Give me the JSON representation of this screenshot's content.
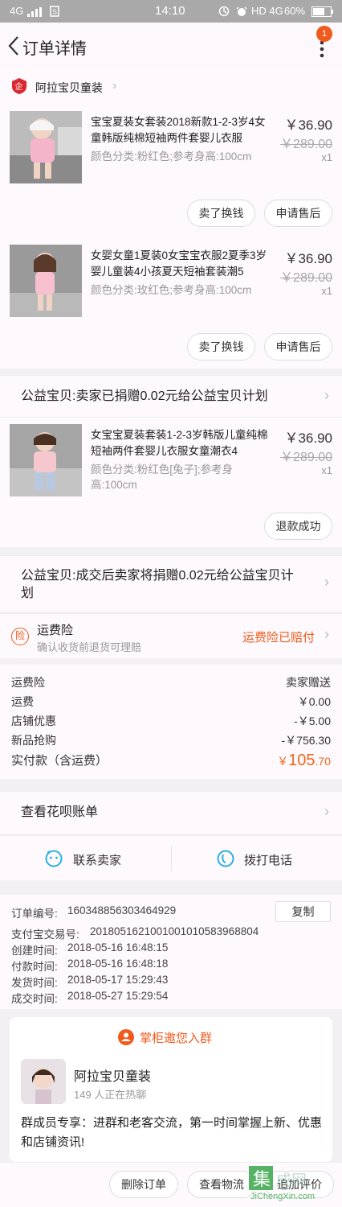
{
  "statusbar": {
    "network": "4G",
    "time": "14:10",
    "indicators": "HD 4G",
    "battery": "60%"
  },
  "navbar": {
    "title": "订单详情",
    "badge_count": "1"
  },
  "shop": {
    "name": "阿拉宝贝童装"
  },
  "items": [
    {
      "title": "宝宝夏装女套装2018新款1-2-3岁4女童韩版纯棉短袖两件套婴儿衣服",
      "sku": "颜色分类:粉红色;参考身高:100cm",
      "price": "￥36.90",
      "original_price": "￥289.00",
      "qty": "x1"
    },
    {
      "title": "女婴女童1夏装0女宝宝衣服2夏季3岁婴儿童装4小孩夏天短袖套装潮5",
      "sku": "颜色分类:玫红色;参考身高:100cm",
      "price": "￥36.90",
      "original_price": "￥289.00",
      "qty": "x1"
    },
    {
      "title": "女宝宝夏装套装1-2-3岁韩版儿童纯棉短袖两件套婴儿衣服女童潮衣4",
      "sku": "颜色分类:粉红色[兔子];参考身高:100cm",
      "price": "￥36.90",
      "original_price": "￥289.00",
      "qty": "x1"
    }
  ],
  "buttons": {
    "sell_exchange": "卖了换钱",
    "apply_aftersale": "申请售后",
    "refund_success": "退款成功"
  },
  "charity": {
    "line1": "公益宝贝:卖家已捐赠0.02元给公益宝贝计划",
    "line2": "公益宝贝:成交后卖家将捐赠0.02元给公益宝贝计划"
  },
  "insurance": {
    "icon_text": "险",
    "title": "运费险",
    "subtitle": "确认收货前退货可理赔",
    "status": "运费险已赔付"
  },
  "fees": [
    {
      "label": "运费险",
      "value": "卖家赠送"
    },
    {
      "label": "运费",
      "value": "￥0.00"
    },
    {
      "label": "店铺优惠",
      "value": "-￥5.00"
    },
    {
      "label": "新品抢购",
      "value": "-￥756.30"
    }
  ],
  "total": {
    "label": "实付款（含运费）",
    "currency": "￥",
    "integer": "105",
    "decimal": ".70"
  },
  "huabei": {
    "label": "查看花呗账单"
  },
  "contact": {
    "seller": "联系卖家",
    "call": "拨打电话"
  },
  "order_info": [
    {
      "label": "订单编号:",
      "value": "160348856303464929"
    },
    {
      "label": "支付宝交易号:",
      "value": "2018051621001001010583968804"
    },
    {
      "label": "创建时间:",
      "value": "2018-05-16 16:48:15"
    },
    {
      "label": "付款时间:",
      "value": "2018-05-16 16:48:18"
    },
    {
      "label": "发货时间:",
      "value": "2018-05-17 15:29:43"
    },
    {
      "label": "成交时间:",
      "value": "2018-05-27 15:29:54"
    }
  ],
  "copy_label": "复制",
  "group": {
    "header": "掌柜邀您入群",
    "name": "阿拉宝贝童装",
    "members": "149 人正在热聊",
    "description": "群成员专享：进群和老客交流，第一时间掌握上新、优惠和店铺资讯!"
  },
  "bottom": {
    "delete": "删除订单",
    "logistics": "查看物流",
    "review": "追加评价"
  },
  "watermark": {
    "text": "JiChengXin.com"
  },
  "colors": {
    "accent": "#f05a1d",
    "price_highlight": "#f0661b"
  }
}
